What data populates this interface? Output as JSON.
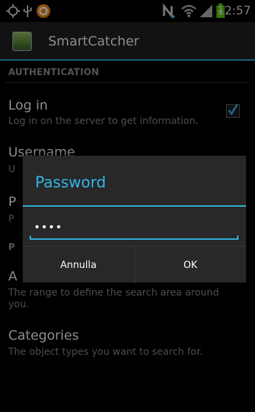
{
  "status_bar": {
    "time": "12:57",
    "icons": [
      "gps-icon",
      "usb-icon",
      "notification-app-icon",
      "nfc-icon",
      "wifi-icon",
      "signal-icon",
      "battery-icon"
    ],
    "accent_colors": {
      "battery": "#5ad300",
      "notification": "#ff8a00"
    }
  },
  "action_bar": {
    "title": "SmartCatcher",
    "accent": "#33b5e5"
  },
  "preferences": {
    "section_authentication": "AUTHENTICATION",
    "login_title": "Log in",
    "login_summary": "Log in on the server to get information.",
    "login_checked": true,
    "username_title": "Username",
    "username_summary_partial": "U",
    "password_title_partial": "P",
    "password_summary_partial": "P",
    "section_partial": "P",
    "area_title_partial": "A",
    "area_summary": "The range to define the search area around you.",
    "categories_title": "Categories",
    "categories_summary": "The object types you want to search for."
  },
  "dialog": {
    "title": "Password",
    "password_value": "••••",
    "cancel_label": "Annulla",
    "ok_label": "OK"
  }
}
